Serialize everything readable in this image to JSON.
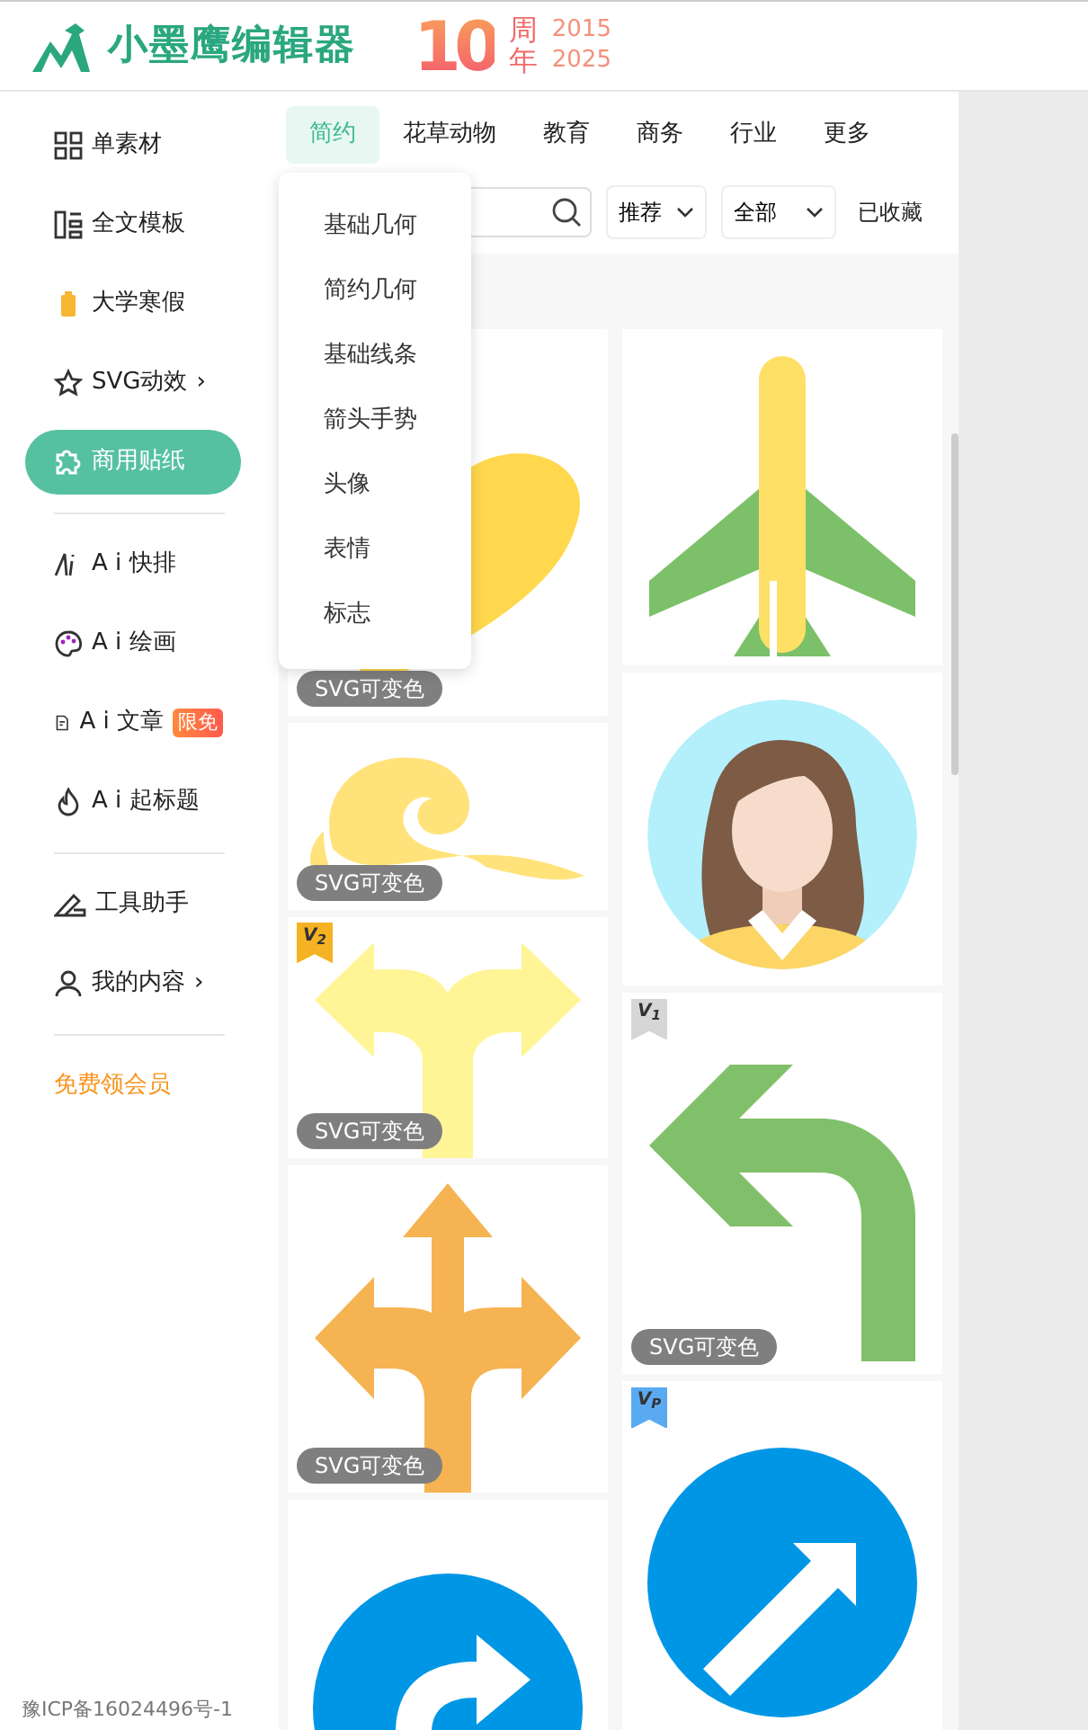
{
  "header": {
    "brand": "小墨鹰编辑器",
    "anniversary": {
      "number": "10",
      "chars": [
        "周",
        "年"
      ],
      "years": [
        "2015",
        "2025"
      ]
    }
  },
  "sidebar": {
    "sections": [
      [
        {
          "label": "单素材",
          "kind": "link",
          "selected": false
        },
        {
          "label": "全文模板",
          "kind": "link",
          "selected": false
        },
        {
          "label": "大学寒假",
          "kind": "link",
          "selected": false
        },
        {
          "label": "SVG动效",
          "kind": "link",
          "selected": false,
          "arrow": "›"
        },
        {
          "label": "商用贴纸",
          "kind": "link",
          "selected": true
        }
      ],
      [
        {
          "label": "A i 快排",
          "kind": "link",
          "selected": false
        },
        {
          "label": "A i 绘画",
          "kind": "link",
          "selected": false
        },
        {
          "label": "A i 文章",
          "kind": "link",
          "selected": false,
          "badge": "限免"
        },
        {
          "label": "A i 起标题",
          "kind": "link",
          "selected": false
        }
      ],
      [
        {
          "label": "工具助手",
          "kind": "link",
          "selected": false
        },
        {
          "label": "我的内容",
          "kind": "link",
          "selected": false,
          "arrow": "›"
        }
      ],
      [
        {
          "label": "免费领会员",
          "kind": "promo",
          "selected": false
        }
      ]
    ],
    "footer": "豫ICP备16024496号-1"
  },
  "tabs": [
    {
      "label": "简约",
      "selected": true
    },
    {
      "label": "花草动物",
      "selected": false
    },
    {
      "label": "教育",
      "selected": false
    },
    {
      "label": "商务",
      "selected": false
    },
    {
      "label": "行业",
      "selected": false
    },
    {
      "label": "更多",
      "selected": false
    }
  ],
  "filters": {
    "sort": "推荐",
    "scope": "全部",
    "favorites": "已收藏"
  },
  "dropdown": [
    "基础几何",
    "简约几何",
    "基础线条",
    "箭头手势",
    "头像",
    "表情",
    "标志"
  ],
  "columns": [
    [
      {
        "kind": "heart",
        "tag": "SVG可变色"
      },
      {
        "kind": "cloud",
        "tag": "SVG可变色"
      },
      {
        "kind": "fork-arrow",
        "tag": "SVG可变色",
        "badge": "V$_{2}$",
        "color": "#f5b323"
      },
      {
        "kind": "cross-arrow",
        "tag": "SVG可变色"
      },
      {
        "kind": "turn-sign"
      }
    ],
    [
      {
        "kind": "airplane"
      },
      {
        "kind": "avatar"
      },
      {
        "kind": "turn-left-arrow",
        "tag": "SVG可变色",
        "badge": "V$_{1}$",
        "color": "#d6d6d6"
      },
      {
        "kind": "diagonal-sign",
        "badge": "V$_{P}$",
        "color": "#5aaaf2"
      }
    ]
  ]
}
